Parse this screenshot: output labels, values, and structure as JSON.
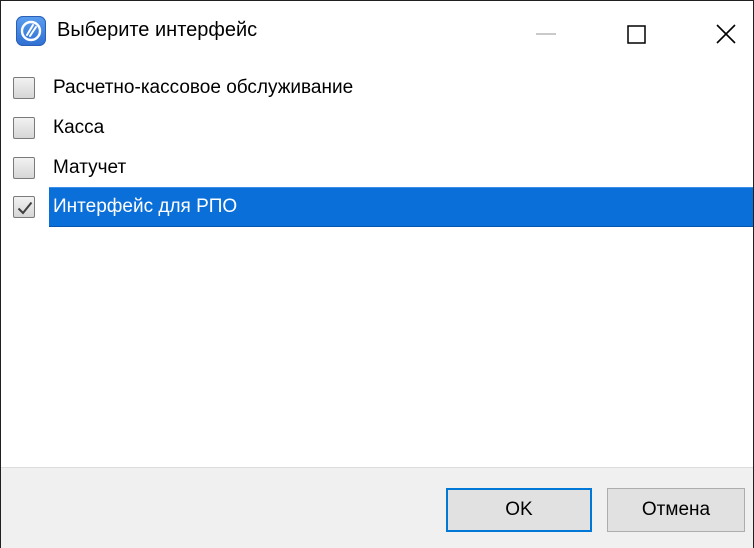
{
  "window": {
    "title": "Выберите интерфейс",
    "app_icon": "app-logo-icon"
  },
  "titlebar_buttons": {
    "minimize": "minimize-icon",
    "maximize": "maximize-icon",
    "close": "close-icon"
  },
  "list": {
    "items": [
      {
        "label": "Расчетно-кассовое обслуживание",
        "checked": false,
        "selected": false
      },
      {
        "label": "Касса",
        "checked": false,
        "selected": false
      },
      {
        "label": "Матучет",
        "checked": false,
        "selected": false
      },
      {
        "label": "Интерфейс для РПО",
        "checked": true,
        "selected": true
      }
    ]
  },
  "buttons": {
    "ok_label": "OK",
    "cancel_label": "Отмена"
  },
  "colors": {
    "selection": "#0a6fd8",
    "default_button_border": "#0078d7"
  }
}
